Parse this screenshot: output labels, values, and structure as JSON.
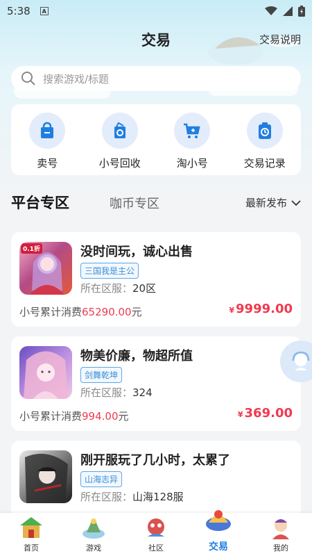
{
  "status_bar": {
    "time": "5:38",
    "notif": "A"
  },
  "header": {
    "title": "交易",
    "help": "交易说明"
  },
  "search": {
    "placeholder": "搜索游戏/标题"
  },
  "quick_actions": [
    {
      "label": "卖号",
      "icon": "bag-icon"
    },
    {
      "label": "小号回收",
      "icon": "recycle-icon"
    },
    {
      "label": "淘小号",
      "icon": "cart-icon"
    },
    {
      "label": "交易记录",
      "icon": "clipboard-clock-icon"
    }
  ],
  "tabs": {
    "platform": "平台专区",
    "coin": "咖币专区",
    "sort": "最新发布"
  },
  "listings": [
    {
      "title": "没时间玩，诚心出售",
      "game": "三国我是主公",
      "server_label": "所在区服：",
      "server": "20区",
      "spend_label": "小号累计消费",
      "spend": "65290.00",
      "spend_unit": "元",
      "currency": "¥",
      "price": "9999.00",
      "badge": "0.1折"
    },
    {
      "title": "物美价廉，物超所值",
      "game": "剑舞乾坤",
      "server_label": "所在区服：",
      "server": "324",
      "spend_label": "小号累计消费",
      "spend": "994.00",
      "spend_unit": "元",
      "currency": "¥",
      "price": "369.00"
    },
    {
      "title": "刚开服玩了几小时，太累了",
      "game": "山海志异",
      "server_label": "所在区服：",
      "server": "山海128服"
    }
  ],
  "bottom_nav": [
    {
      "label": "首页",
      "icon": "home-icon"
    },
    {
      "label": "游戏",
      "icon": "game-icon"
    },
    {
      "label": "社区",
      "icon": "community-icon"
    },
    {
      "label": "交易",
      "icon": "trade-icon"
    },
    {
      "label": "我的",
      "icon": "profile-icon"
    }
  ],
  "colors": {
    "accent": "#1f7fe0",
    "price": "#f0394f",
    "tag": "#3a8fd8"
  }
}
